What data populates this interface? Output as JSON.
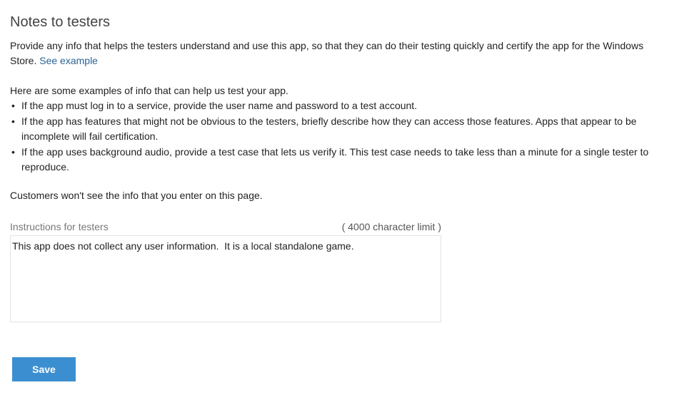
{
  "heading": {
    "title": "Notes to testers"
  },
  "intro": {
    "text": "Provide any info that helps the testers understand and use this app, so that they can do their testing quickly and certify the app for the Windows Store.",
    "link_label": "See example"
  },
  "examples": {
    "heading": "Here are some examples of info that can help us test your app.",
    "items": [
      "If the app must log in to a service, provide the user name and password to a test account.",
      "If the app has features that might not be obvious to the testers, briefly describe how they can access those features. Apps that appear to be incomplete will fail certification.",
      "If the app uses background audio, provide a test case that lets us verify it. This test case needs to take less than a minute for a single tester to reproduce."
    ]
  },
  "customers_note": "Customers won't see the info that you enter on this page.",
  "instructions_field": {
    "label": "Instructions for testers",
    "char_limit": "( 4000 character limit )",
    "value": "This app does not collect any user information.  It is a local standalone game."
  },
  "actions": {
    "save_label": "Save"
  }
}
